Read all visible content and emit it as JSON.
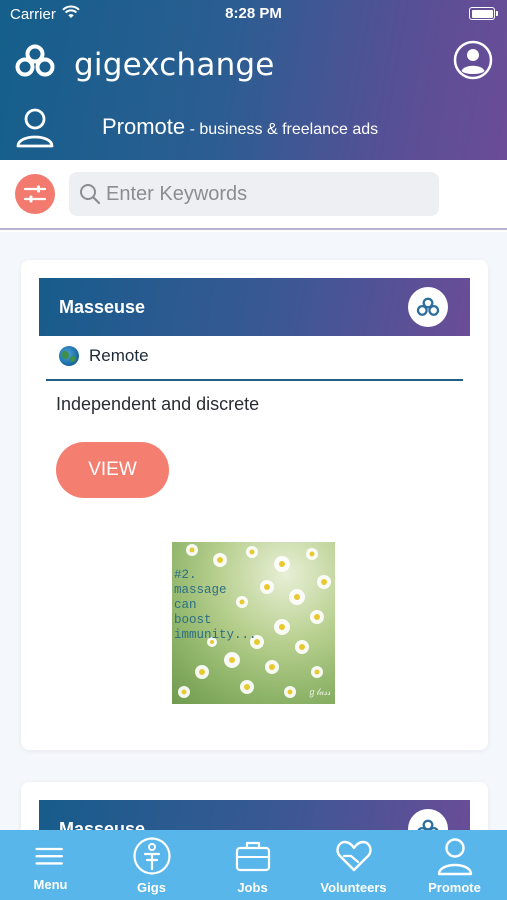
{
  "status_bar": {
    "carrier": "Carrier",
    "time": "8:28 PM"
  },
  "header": {
    "brand": "gigexchange",
    "page_title": "Promote",
    "page_subtitle": " - business & freelance ads"
  },
  "search": {
    "placeholder": "Enter Keywords",
    "value": ""
  },
  "cards": [
    {
      "title": "Masseuse",
      "location": "Remote",
      "description": "Independent and discrete",
      "button_label": "VIEW",
      "image_text": "#2.\nmassage\ncan\nboost\nimmunity..."
    },
    {
      "title": "Masseuse"
    }
  ],
  "tabbar": {
    "items": [
      {
        "label": "Menu",
        "icon": "menu-icon"
      },
      {
        "label": "Gigs",
        "icon": "gigs-icon"
      },
      {
        "label": "Jobs",
        "icon": "briefcase-icon"
      },
      {
        "label": "Volunteers",
        "icon": "heart-hand-icon"
      },
      {
        "label": "Promote",
        "icon": "person-icon"
      }
    ]
  },
  "colors": {
    "header_start": "#145f8b",
    "header_end": "#6b4c98",
    "accent_coral": "#f47e70",
    "tabbar": "#59b6ea"
  }
}
